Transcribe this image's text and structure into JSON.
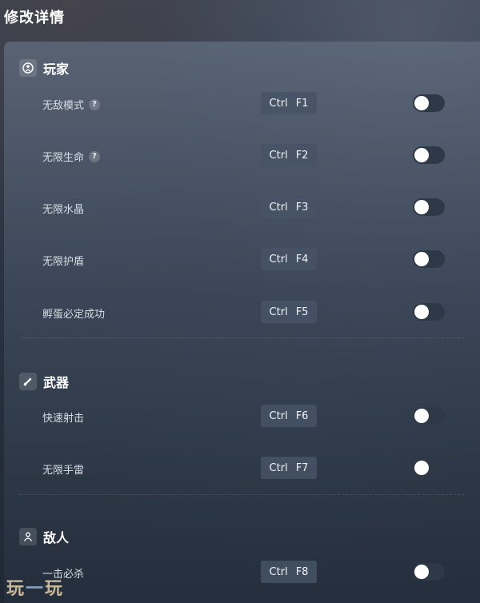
{
  "page": {
    "title": "修改详情"
  },
  "sections": [
    {
      "title": "玩家",
      "icon": "player-icon"
    },
    {
      "title": "武器",
      "icon": "weapon-icon"
    },
    {
      "title": "敌人",
      "icon": "enemy-icon"
    }
  ],
  "rows": [
    {
      "label": "无敌模式",
      "help": "?",
      "key1": "Ctrl",
      "key2": "F1",
      "enabled": false
    },
    {
      "label": "无限生命",
      "help": "?",
      "key1": "Ctrl",
      "key2": "F2",
      "enabled": false
    },
    {
      "label": "无限水晶",
      "key1": "Ctrl",
      "key2": "F3",
      "enabled": false
    },
    {
      "label": "无限护盾",
      "key1": "Ctrl",
      "key2": "F4",
      "enabled": false
    },
    {
      "label": "孵蛋必定成功",
      "key1": "Ctrl",
      "key2": "F5",
      "enabled": false
    },
    {
      "label": "快速射击",
      "key1": "Ctrl",
      "key2": "F6",
      "enabled": false
    },
    {
      "label": "无限手雷",
      "key1": "Ctrl",
      "key2": "F7",
      "enabled": false
    },
    {
      "label": "一击必杀",
      "key1": "Ctrl",
      "key2": "F8",
      "enabled": false
    }
  ],
  "watermark": {
    "left": "玩",
    "mid": "一",
    "right": "玩"
  }
}
